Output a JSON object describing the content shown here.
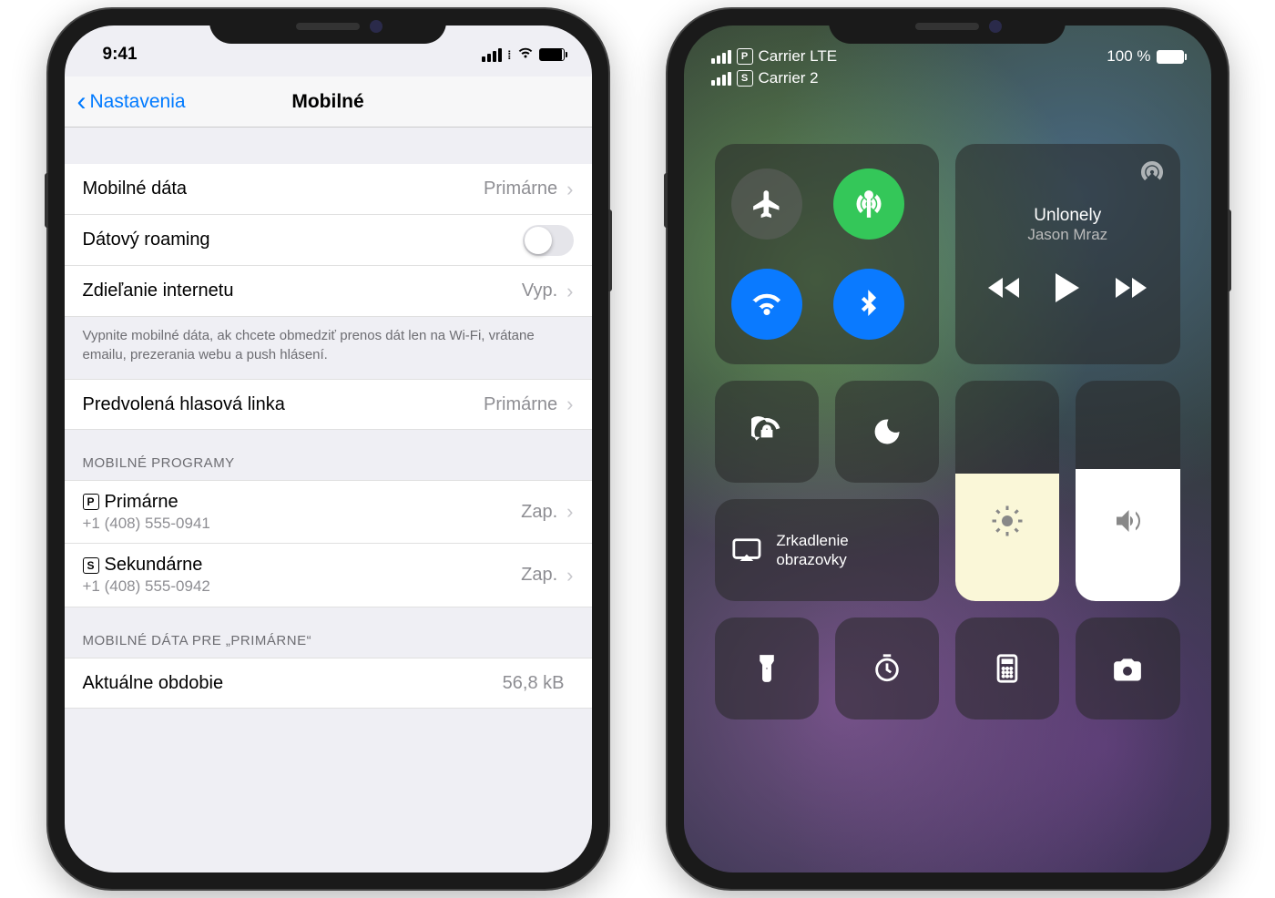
{
  "settings": {
    "status": {
      "time": "9:41"
    },
    "nav": {
      "back": "Nastavenia",
      "title": "Mobilné"
    },
    "rows": {
      "cellular_data": {
        "label": "Mobilné dáta",
        "value": "Primárne"
      },
      "roaming": {
        "label": "Dátový roaming"
      },
      "hotspot": {
        "label": "Zdieľanie internetu",
        "value": "Vyp."
      },
      "footnote": "Vypnite mobilné dáta, ak chcete obmedziť prenos dát len na Wi-Fi, vrátane emailu, prezerania webu a push hlásení.",
      "default_voice": {
        "label": "Predvolená hlasová linka",
        "value": "Primárne"
      }
    },
    "plans": {
      "header": "MOBILNÉ PROGRAMY",
      "items": [
        {
          "badge": "P",
          "label": "Primárne",
          "number": "+1 (408) 555-0941",
          "state": "Zap."
        },
        {
          "badge": "S",
          "label": "Sekundárne",
          "number": "+1 (408) 555-0942",
          "state": "Zap."
        }
      ]
    },
    "usage": {
      "header": "MOBILNÉ DÁTA PRE „PRIMÁRNE“",
      "period": {
        "label": "Aktuálne obdobie",
        "value": "56,8 kB"
      }
    }
  },
  "cc": {
    "status": {
      "line1": {
        "badge": "P",
        "text": "Carrier LTE"
      },
      "line2": {
        "badge": "S",
        "text": "Carrier 2"
      },
      "battery": "100 %"
    },
    "media": {
      "title": "Unlonely",
      "artist": "Jason Mraz"
    },
    "mirror": "Zrkadlenie obrazovky"
  }
}
